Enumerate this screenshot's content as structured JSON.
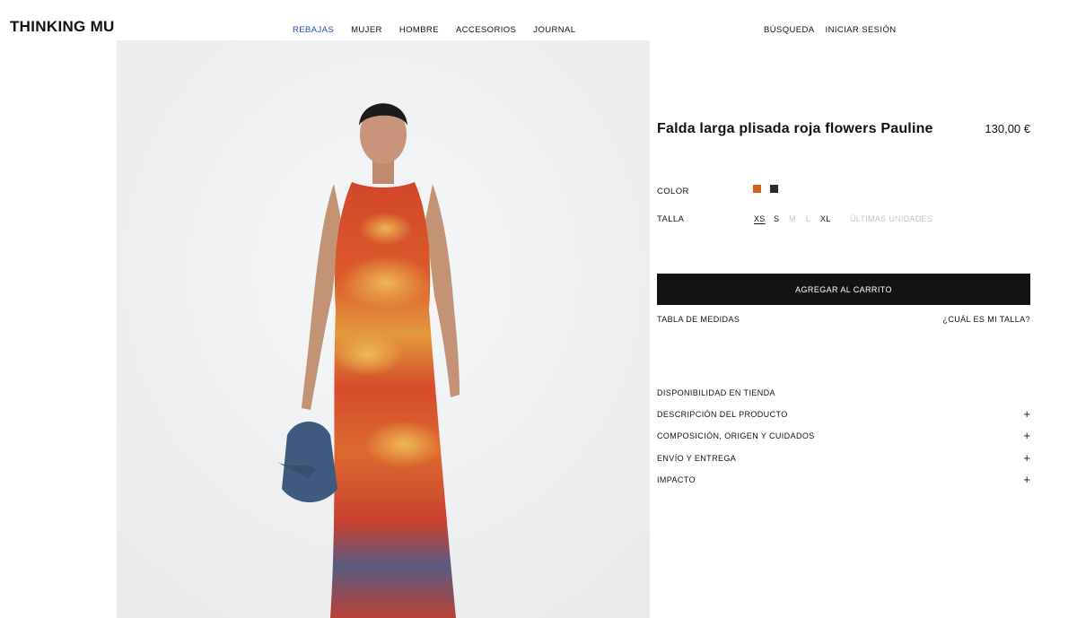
{
  "header": {
    "logo": "THINKING MU",
    "nav": [
      "REBAJAS",
      "MUJER",
      "HOMBRE",
      "ACCESORIOS",
      "JOURNAL"
    ],
    "active_color": "#2a4fb4",
    "search": "BÚSQUEDA",
    "login": "INICIAR SESIÓN"
  },
  "product": {
    "title": "Falda larga plisada roja flowers Pauline",
    "price": "130,00 €",
    "color_label": "COLOR",
    "colors": [
      "#d0621f",
      "#2b2b2b"
    ],
    "size_label": "TALLA",
    "sizes": [
      "XS",
      "S",
      "M",
      "L",
      "XL"
    ],
    "selected_size": "XS",
    "unavailable_sizes": [
      "M",
      "L"
    ],
    "stock_note": "ÚLTIMAS UNIDADES",
    "add_to_cart": "AGREGAR AL CARRITO",
    "size_chart": "TABLA DE MEDIDAS",
    "which_size": "¿CUÁL ES MI TALLA?",
    "store_availability": "DISPONIBILIDAD EN TIENDA",
    "accordions": [
      {
        "label": "DESCRIPCIÓN DEL PRODUCTO",
        "icon": "+"
      },
      {
        "label": "COMPOSICIÓN, ORIGEN Y CUIDADOS",
        "icon": "+"
      },
      {
        "label": "ENVÍO Y ENTREGA",
        "icon": "+"
      },
      {
        "label": "IMPACTO",
        "icon": "+"
      }
    ]
  }
}
